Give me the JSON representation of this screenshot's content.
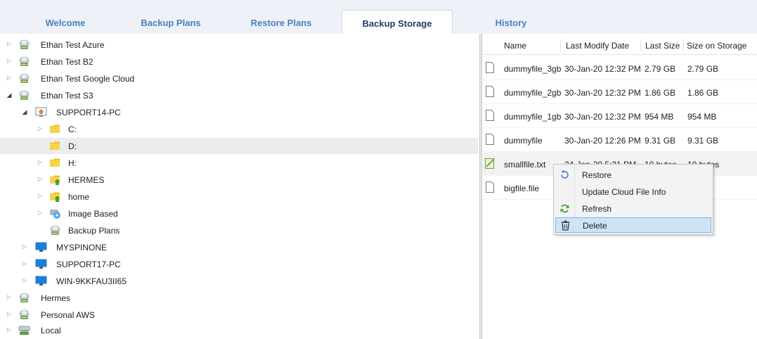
{
  "tabs": [
    {
      "label": "Welcome",
      "active": false
    },
    {
      "label": "Backup Plans",
      "active": false
    },
    {
      "label": "Restore Plans",
      "active": false
    },
    {
      "label": "Backup Storage",
      "active": true
    },
    {
      "label": "History",
      "active": false
    }
  ],
  "tree": {
    "items": [
      {
        "label": "Ethan Test Azure",
        "icon": "cloud-storage-icon",
        "expanded": false
      },
      {
        "label": "Ethan Test B2",
        "icon": "cloud-storage-icon",
        "expanded": false
      },
      {
        "label": "Ethan Test Google Cloud",
        "icon": "cloud-storage-icon",
        "expanded": false
      },
      {
        "label": "Ethan Test S3",
        "icon": "cloud-storage-icon",
        "expanded": true
      },
      {
        "label": "SUPPORT14-PC",
        "icon": "computer-home-icon",
        "expanded": true
      },
      {
        "label": "C:",
        "icon": "folder-icon",
        "expanded": false
      },
      {
        "label": "D:",
        "icon": "folder-icon",
        "expanded": false,
        "selected": true
      },
      {
        "label": "H:",
        "icon": "folder-icon",
        "expanded": false
      },
      {
        "label": "HERMES",
        "icon": "network-folder-icon",
        "expanded": false
      },
      {
        "label": "home",
        "icon": "network-folder-icon",
        "expanded": false
      },
      {
        "label": "Image Based",
        "icon": "disk-image-icon",
        "expanded": false
      },
      {
        "label": "Backup Plans",
        "icon": "cloud-storage-icon",
        "expanded": false
      },
      {
        "label": "MYSPINONE",
        "icon": "monitor-icon",
        "expanded": false
      },
      {
        "label": "SUPPORT17-PC",
        "icon": "monitor-icon",
        "expanded": false
      },
      {
        "label": "WIN-9KKFAU3II65",
        "icon": "monitor-icon",
        "expanded": false
      },
      {
        "label": "Hermes",
        "icon": "cloud-storage-icon",
        "expanded": false
      },
      {
        "label": "Personal AWS",
        "icon": "cloud-storage-icon",
        "expanded": false
      },
      {
        "label": "Local",
        "icon": "local-storage-icon",
        "expanded": false
      }
    ]
  },
  "files": {
    "columns": [
      "Name",
      "Last Modify Date",
      "Last Size",
      "Size on Storage"
    ],
    "rows": [
      {
        "name": "dummyfile_3gb",
        "date": "30-Jan-20 12:32 PM",
        "size": "2.79 GB",
        "storage": "2.79 GB",
        "icon": "file-icon"
      },
      {
        "name": "dummyfile_2gb",
        "date": "30-Jan-20 12:32 PM",
        "size": "1.86 GB",
        "storage": "1.86 GB",
        "icon": "file-icon"
      },
      {
        "name": "dummyfile_1gb",
        "date": "30-Jan-20 12:32 PM",
        "size": "954 MB",
        "storage": "954 MB",
        "icon": "file-icon"
      },
      {
        "name": "dummyfile",
        "date": "30-Jan-20 12:26 PM",
        "size": "9.31 GB",
        "storage": "9.31 GB",
        "icon": "file-icon"
      },
      {
        "name": "smallfile.txt",
        "date": "24-Jan-20 5:21 PM",
        "size": "10 bytes",
        "storage": "10 bytes",
        "icon": "text-file-icon"
      },
      {
        "name": "bigfile.file",
        "date": "",
        "size": "",
        "storage": "B",
        "icon": "file-icon"
      }
    ]
  },
  "context_menu": {
    "items": [
      {
        "label": "Restore",
        "icon": "restore-icon"
      },
      {
        "label": "Update Cloud File Info",
        "icon": ""
      },
      {
        "label": "Refresh",
        "icon": "refresh-icon"
      },
      {
        "label": "Delete",
        "icon": "trash-icon",
        "active": true
      }
    ]
  }
}
